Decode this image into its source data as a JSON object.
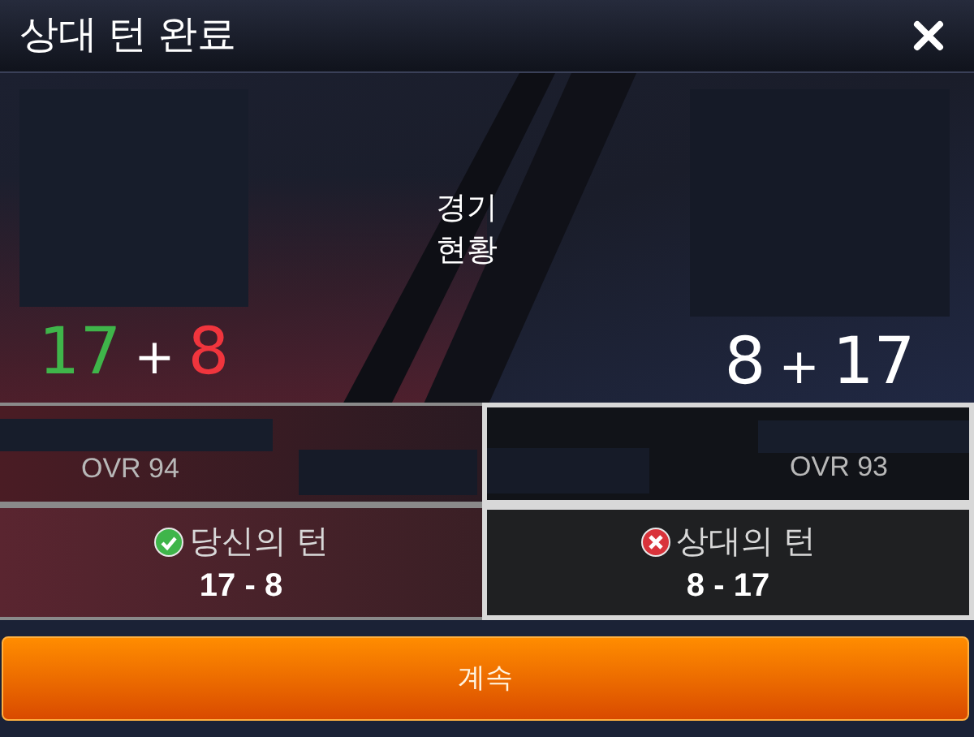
{
  "title": "상대 턴 완료",
  "center_label": "경기\n현황",
  "players": [
    {
      "kind": "home",
      "score_parts": [
        {
          "text": "17",
          "color": "#3fb54a"
        },
        {
          "text": "+",
          "color": "#ffffff"
        },
        {
          "text": "8",
          "color": "#f0353d"
        }
      ],
      "ovr": "OVR 94",
      "highlighted": false,
      "turn": {
        "kind": "win",
        "label": "당신의 턴",
        "score": "17 - 8"
      }
    },
    {
      "kind": "away",
      "score_parts": [
        {
          "text": "8",
          "color": "#ffffff"
        },
        {
          "text": "+",
          "color": "#ffffff"
        },
        {
          "text": "17",
          "color": "#ffffff"
        }
      ],
      "ovr": "OVR 93",
      "highlighted": true,
      "turn": {
        "kind": "loss",
        "label": "상대의 턴",
        "score": "8 - 17"
      }
    }
  ],
  "button": "계속"
}
